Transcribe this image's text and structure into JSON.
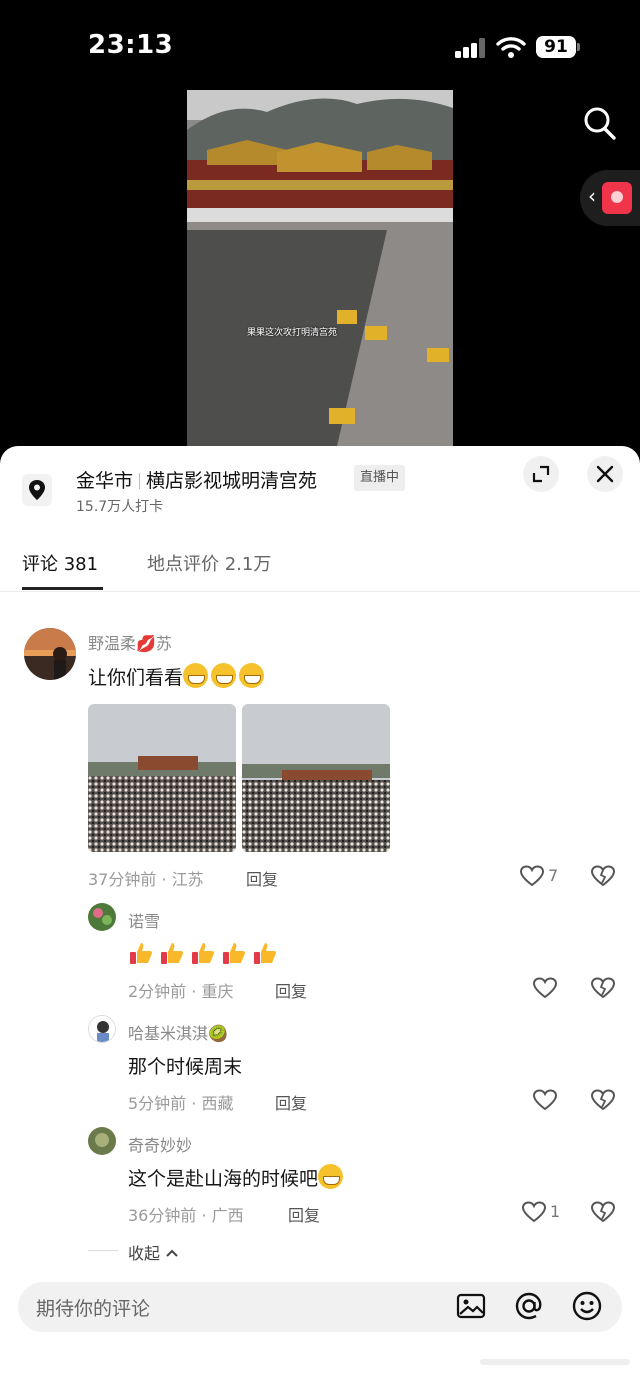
{
  "status_bar": {
    "time": "23:13",
    "battery": "91"
  },
  "video": {
    "caption": "果果这次攻打明清宫苑"
  },
  "location": {
    "city": "金华市",
    "place": "横店影视城明清宫苑",
    "live_badge": "直播中",
    "checkins": "15.7万人打卡"
  },
  "tabs": [
    {
      "label": "评论 381"
    },
    {
      "label": "地点评价 2.1万"
    }
  ],
  "comments": {
    "main": {
      "user": "野温柔💋苏",
      "text": "让你们看看",
      "meta": "37分钟前 · 江苏",
      "reply": "回复",
      "likes": "7"
    },
    "replies": [
      {
        "user": "诺雪",
        "text": "",
        "meta": "2分钟前 · 重庆",
        "reply": "回复",
        "likes": ""
      },
      {
        "user": "哈基米淇淇🥝",
        "text": "那个时候周末",
        "meta": "5分钟前 · 西藏",
        "reply": "回复",
        "likes": ""
      },
      {
        "user": "奇奇妙妙",
        "text": "这个是赴山海的时候吧",
        "meta": "36分钟前 · 广西",
        "reply": "回复",
        "likes": "1"
      }
    ],
    "collapse": "收起"
  },
  "input": {
    "placeholder": "期待你的评论"
  },
  "icons": {
    "search": "search-icon",
    "location": "location-pin-icon",
    "expand": "expand-icon",
    "close": "close-icon",
    "like": "heart-icon",
    "dislike": "broken-heart-icon",
    "image": "image-icon",
    "mention": "at-icon",
    "emoji": "emoji-icon"
  }
}
